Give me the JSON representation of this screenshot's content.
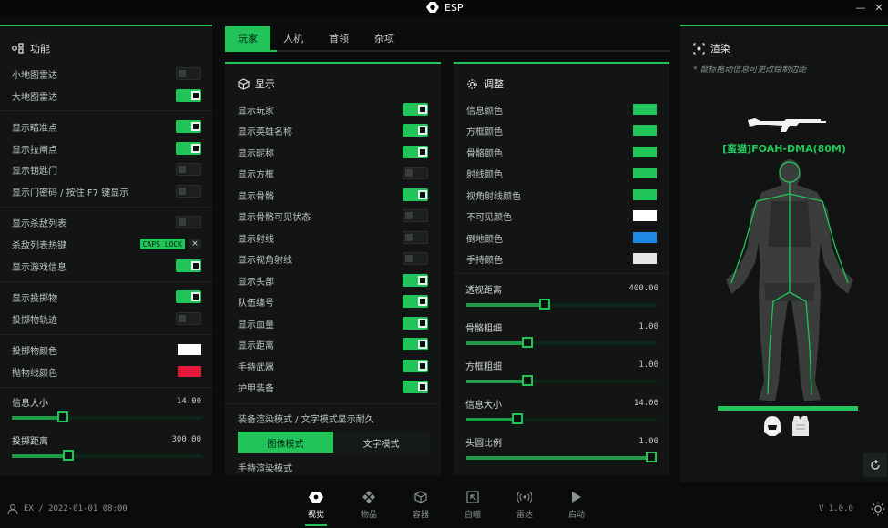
{
  "window": {
    "title": "ESP",
    "minimize": "—",
    "close": "✕"
  },
  "colors": {
    "accent": "#20c459",
    "panel": "#121513",
    "bg": "#0b0d0c"
  },
  "left": {
    "title": "功能",
    "items": [
      {
        "label": "小地图雷达",
        "type": "toggle",
        "on": false
      },
      {
        "label": "大地图雷达",
        "type": "toggle",
        "on": true
      },
      {
        "label": "显示瞄准点",
        "type": "toggle",
        "on": true
      },
      {
        "label": "显示拉闸点",
        "type": "toggle",
        "on": true
      },
      {
        "label": "显示钥匙门",
        "type": "toggle",
        "on": false
      },
      {
        "label": "显示门密码 / 按住 F7 键显示",
        "type": "toggle",
        "on": false
      },
      {
        "label": "显示杀敌列表",
        "type": "toggle",
        "on": false
      },
      {
        "label": "杀敌列表热键",
        "type": "hotkey",
        "key": "CAPS LOCK",
        "clear": "×"
      },
      {
        "label": "显示游戏信息",
        "type": "toggle",
        "on": true
      },
      {
        "label": "显示投掷物",
        "type": "toggle",
        "on": true
      },
      {
        "label": "投掷物轨迹",
        "type": "toggle",
        "on": false
      },
      {
        "label": "投掷物颜色",
        "type": "color",
        "color": "#ffffff"
      },
      {
        "label": "抛物线颜色",
        "type": "color",
        "color": "#e8183a"
      }
    ],
    "sliders": [
      {
        "label": "信息大小",
        "value": "14.00",
        "fraction": 0.27
      },
      {
        "label": "投掷距离",
        "value": "300.00",
        "fraction": 0.3
      }
    ]
  },
  "tabs": [
    "玩家",
    "人机",
    "首领",
    "杂项"
  ],
  "display": {
    "title": "显示",
    "items": [
      {
        "label": "显示玩家",
        "on": true
      },
      {
        "label": "显示英雄名称",
        "on": true
      },
      {
        "label": "显示昵称",
        "on": true
      },
      {
        "label": "显示方框",
        "on": false
      },
      {
        "label": "显示骨骼",
        "on": true
      },
      {
        "label": "显示骨骼可见状态",
        "on": false
      },
      {
        "label": "显示射线",
        "on": false
      },
      {
        "label": "显示视角射线",
        "on": false
      },
      {
        "label": "显示头部",
        "on": true
      },
      {
        "label": "队伍编号",
        "on": true
      },
      {
        "label": "显示血量",
        "on": true
      },
      {
        "label": "显示距离",
        "on": true
      },
      {
        "label": "手持武器",
        "on": true
      },
      {
        "label": "护甲装备",
        "on": true
      }
    ],
    "equip_caption": "装备渲染模式 / 文字模式显示耐久",
    "mode_options": [
      "图像模式",
      "文字模式"
    ],
    "mode_selected": "图像模式",
    "held_caption": "手持渲染模式"
  },
  "adjust": {
    "title": "调整",
    "colors": [
      {
        "label": "信息颜色",
        "color": "#20c459"
      },
      {
        "label": "方框颜色",
        "color": "#20c459"
      },
      {
        "label": "骨骼颜色",
        "color": "#20c459"
      },
      {
        "label": "射线颜色",
        "color": "#20c459"
      },
      {
        "label": "视角射线颜色",
        "color": "#20c459"
      },
      {
        "label": "不可见颜色",
        "color": "#ffffff"
      },
      {
        "label": "倒地颜色",
        "color": "#1e88e5"
      },
      {
        "label": "手持颜色",
        "color": "#e6e6e6"
      }
    ],
    "sliders": [
      {
        "label": "透视距离",
        "value": "400.00",
        "fraction": 0.41
      },
      {
        "label": "骨骼粗细",
        "value": "1.00",
        "fraction": 0.32
      },
      {
        "label": "方框粗细",
        "value": "1.00",
        "fraction": 0.32
      },
      {
        "label": "信息大小",
        "value": "14.00",
        "fraction": 0.27
      },
      {
        "label": "头圆比例",
        "value": "1.00",
        "fraction": 1.0
      }
    ]
  },
  "render": {
    "title": "渲染",
    "hint": "* 鼠标拖动信息可更改绘制边距",
    "player_name": "[蛮猫]FOAH-DMA(80M)"
  },
  "bottom": {
    "user": "EX / 2022-01-01 08:00",
    "nav": [
      {
        "label": "视觉",
        "icon": "eye-icon",
        "active": true
      },
      {
        "label": "物品",
        "icon": "items-icon",
        "active": false
      },
      {
        "label": "容器",
        "icon": "box-icon",
        "active": false
      },
      {
        "label": "自瞄",
        "icon": "aim-icon",
        "active": false
      },
      {
        "label": "雷达",
        "icon": "radar-icon",
        "active": false
      },
      {
        "label": "启动",
        "icon": "play-icon",
        "active": false
      }
    ],
    "version": "V 1.0.0"
  }
}
